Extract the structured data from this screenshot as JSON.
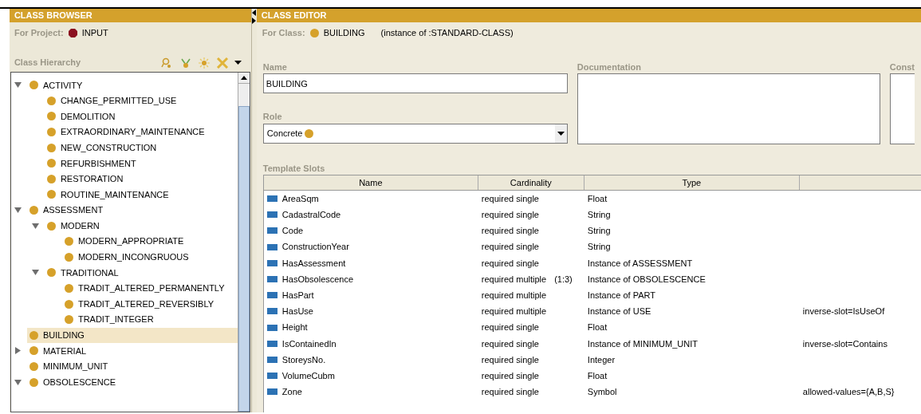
{
  "class_browser": {
    "title": "CLASS BROWSER",
    "project_label": "For Project:",
    "project_name": "INPUT",
    "hierarchy_label": "Class Hierarchy",
    "tree": [
      {
        "label": "ACTIVITY",
        "expanded": true,
        "selected": false,
        "children": [
          {
            "label": "CHANGE_PERMITTED_USE",
            "selected": false
          },
          {
            "label": "DEMOLITION",
            "selected": false
          },
          {
            "label": "EXTRAORDINARY_MAINTENANCE",
            "selected": false
          },
          {
            "label": "NEW_CONSTRUCTION",
            "selected": false
          },
          {
            "label": "REFURBISHMENT",
            "selected": false
          },
          {
            "label": "RESTORATION",
            "selected": false
          },
          {
            "label": "ROUTINE_MAINTENANCE",
            "selected": false
          }
        ]
      },
      {
        "label": "ASSESSMENT",
        "expanded": true,
        "selected": false,
        "children": [
          {
            "label": "MODERN",
            "expanded": true,
            "selected": false,
            "children": [
              {
                "label": "MODERN_APPROPRIATE",
                "selected": false
              },
              {
                "label": "MODERN_INCONGRUOUS",
                "selected": false
              }
            ]
          },
          {
            "label": "TRADITIONAL",
            "expanded": true,
            "selected": false,
            "children": [
              {
                "label": "TRADIT_ALTERED_PERMANENTLY",
                "selected": false
              },
              {
                "label": "TRADIT_ALTERED_REVERSIBLY",
                "selected": false
              },
              {
                "label": "TRADIT_INTEGER",
                "selected": false
              }
            ]
          }
        ]
      },
      {
        "label": "BUILDING",
        "selected": true
      },
      {
        "label": "MATERIAL",
        "expanded": false,
        "selected": false
      },
      {
        "label": "MINIMUM_UNIT",
        "selected": false
      },
      {
        "label": "OBSOLESCENCE",
        "expanded": true,
        "selected": false
      }
    ]
  },
  "class_editor": {
    "title": "CLASS EDITOR",
    "class_label": "For Class:",
    "class_name": "BUILDING",
    "instance_of": "(instance of :STANDARD-CLASS)",
    "name_label": "Name",
    "name_value": "BUILDING",
    "documentation_label": "Documentation",
    "constraints_label": "Const",
    "role_label": "Role",
    "role_value": "Concrete",
    "template_slots_label": "Template Slots",
    "columns": [
      "Name",
      "Cardinality",
      "Type"
    ],
    "rows": [
      {
        "name": "AreaSqm",
        "cardinality": "required single",
        "type": "Float"
      },
      {
        "name": "CadastralCode",
        "cardinality": "required single",
        "type": "String"
      },
      {
        "name": "Code",
        "cardinality": "required single",
        "type": "String"
      },
      {
        "name": "ConstructionYear",
        "cardinality": "required single",
        "type": "String"
      },
      {
        "name": "HasAssessment",
        "cardinality": "required single",
        "type": "Instance of ASSESSMENT"
      },
      {
        "name": "HasObsolescence",
        "cardinality": "required multiple",
        "range": "(1:3)",
        "type": "Instance of OBSOLESCENCE"
      },
      {
        "name": "HasPart",
        "cardinality": "required multiple",
        "type": "Instance of PART"
      },
      {
        "name": "HasUse",
        "cardinality": "required multiple",
        "type": "Instance of USE",
        "column_4": "inverse-slot=IsUseOf"
      },
      {
        "name": "Height",
        "cardinality": "required single",
        "type": "Float"
      },
      {
        "name": "IsContainedIn",
        "cardinality": "required single",
        "type": "Instance of MINIMUM_UNIT",
        "column_4": "inverse-slot=Contains"
      },
      {
        "name": "StoreysNo.",
        "cardinality": "required single",
        "type": "Integer"
      },
      {
        "name": "VolumeCubm",
        "cardinality": "required single",
        "type": "Float"
      },
      {
        "name": "Zone",
        "cardinality": "required single",
        "type": "Symbol",
        "column_4": "allowed-values={A,B,S}"
      }
    ]
  }
}
